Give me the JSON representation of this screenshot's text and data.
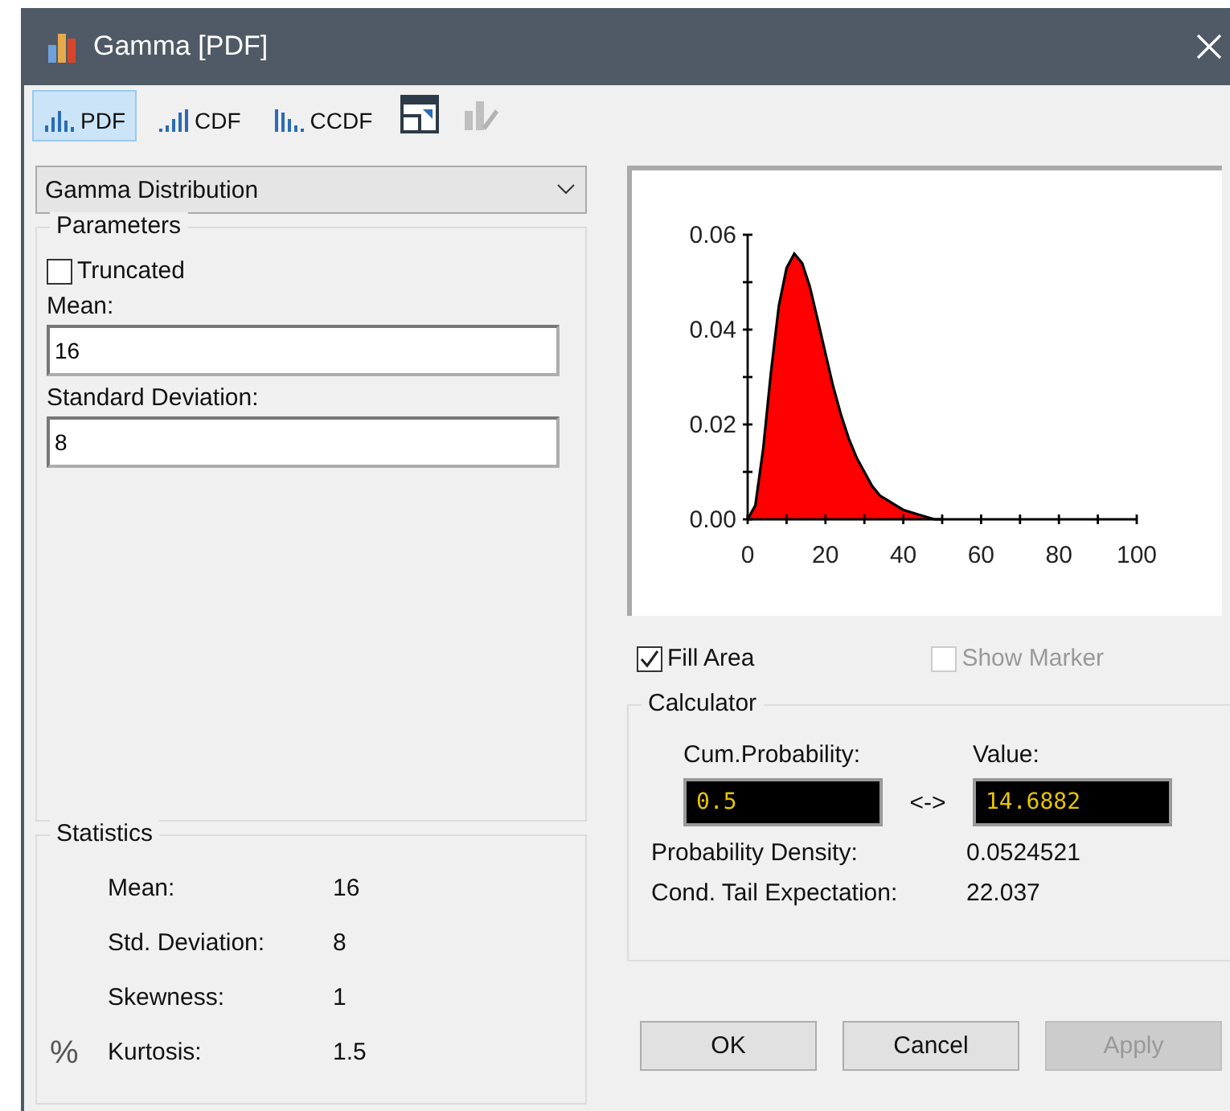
{
  "window": {
    "title": "Gamma [PDF]"
  },
  "toolbar": {
    "tabs": [
      {
        "label": "PDF",
        "kind": "pdf",
        "selected": true
      },
      {
        "label": "CDF",
        "kind": "cdf",
        "selected": false
      },
      {
        "label": "CCDF",
        "kind": "ccdf",
        "selected": false
      }
    ],
    "tools": [
      {
        "kind": "window",
        "disabled": false
      },
      {
        "kind": "edit",
        "disabled": true
      }
    ]
  },
  "distribution": {
    "value": "Gamma Distribution"
  },
  "parameters": {
    "title": "Parameters",
    "truncated": {
      "label": "Truncated",
      "checked": false
    },
    "fields": [
      {
        "label": "Mean:",
        "value": "16"
      },
      {
        "label": "Standard Deviation:",
        "value": "8"
      }
    ]
  },
  "statistics": {
    "title": "Statistics",
    "symbol": "%",
    "rows": [
      {
        "label": "Mean:",
        "value": "16"
      },
      {
        "label": "Std. Deviation:",
        "value": "8"
      },
      {
        "label": "Skewness:",
        "value": "1"
      },
      {
        "label": "Kurtosis:",
        "value": "1.5"
      }
    ]
  },
  "chart": {
    "chart_data": {
      "type": "area",
      "x": [
        0,
        2,
        4,
        6,
        8,
        10,
        12,
        14,
        16,
        18,
        20,
        22,
        24,
        26,
        28,
        30,
        32,
        34,
        36,
        38,
        40,
        44,
        48,
        50
      ],
      "series": [
        {
          "color": "#ff0000",
          "values": [
            0,
            0.003,
            0.015,
            0.031,
            0.045,
            0.053,
            0.056,
            0.054,
            0.049,
            0.042,
            0.035,
            0.028,
            0.022,
            0.017,
            0.013,
            0.01,
            0.007,
            0.005,
            0.004,
            0.003,
            0.002,
            0.001,
            0,
            0
          ]
        }
      ],
      "xlim": [
        0,
        100
      ],
      "ylim": [
        0,
        0.06
      ],
      "xticks": [
        0,
        20,
        40,
        60,
        80,
        100
      ],
      "yticks": [
        {
          "value": 0,
          "label": "0.00"
        },
        {
          "value": 0.02,
          "label": "0.02"
        },
        {
          "value": 0.04,
          "label": "0.04"
        },
        {
          "value": 0.06,
          "label": "0.06"
        }
      ]
    }
  },
  "options": [
    {
      "label": "Fill Area",
      "checked": true,
      "disabled": false
    },
    {
      "label": "Show Marker",
      "checked": false,
      "disabled": true
    }
  ],
  "calculator": {
    "title": "Calculator",
    "probability": {
      "label": "Cum.Probability:",
      "value": "0.5"
    },
    "arrow": "<->",
    "value": {
      "label": "Value:",
      "value": "14.6882"
    },
    "results": [
      {
        "label": "Probability Density:",
        "value": "0.0524521"
      },
      {
        "label": "Cond. Tail Expectation:",
        "value": "22.037"
      }
    ]
  },
  "buttons": [
    {
      "label": "OK",
      "disabled": false
    },
    {
      "label": "Cancel",
      "disabled": false
    },
    {
      "label": "Apply",
      "disabled": true
    }
  ]
}
